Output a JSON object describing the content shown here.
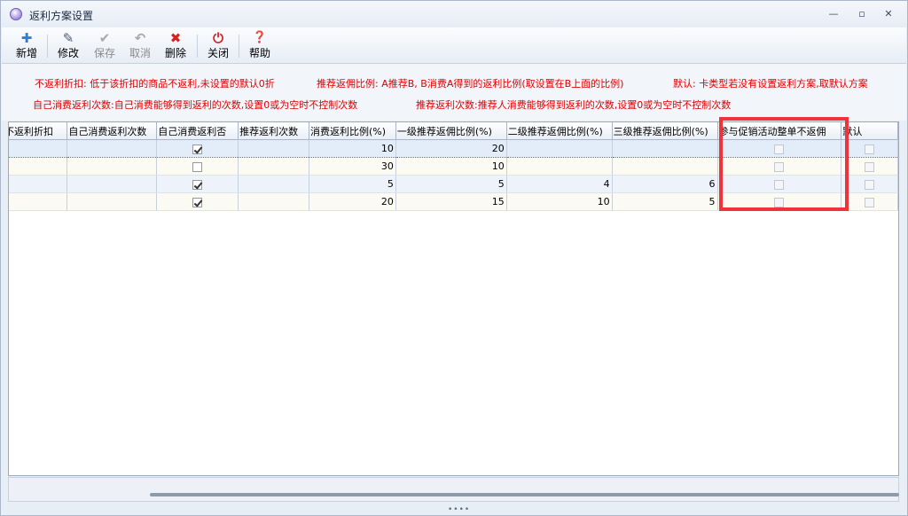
{
  "window": {
    "title": "返利方案设置",
    "controls": [
      "—",
      "▫",
      "✕"
    ]
  },
  "toolbar": {
    "buttons": [
      {
        "label": "新增",
        "icon": "plus-icon",
        "glyph": "✚",
        "color": "#2b7fd6",
        "enabled": true
      },
      {
        "label": "修改",
        "icon": "edit-icon",
        "glyph": "✎",
        "color": "#4b5b75",
        "enabled": true
      },
      {
        "label": "保存",
        "icon": "check-icon",
        "glyph": "✔",
        "color": "#a8a8a8",
        "enabled": false
      },
      {
        "label": "取消",
        "icon": "undo-icon",
        "glyph": "↶",
        "color": "#a8a8a8",
        "enabled": false
      },
      {
        "label": "删除",
        "icon": "delete-icon",
        "glyph": "✖",
        "color": "#d32222",
        "enabled": true
      },
      {
        "label": "关闭",
        "icon": "power-icon",
        "glyph": "⏻",
        "color": "#d32222",
        "enabled": true
      },
      {
        "label": "帮助",
        "icon": "help-icon",
        "glyph": "❓",
        "color": "#2b63c8",
        "enabled": true
      }
    ]
  },
  "info": {
    "line1a": "不返利折扣: 低于该折扣的商品不返利,未设置的默认0折",
    "line1b": "推荐返佣比例: A推荐B, B消费A得到的返利比例(取设置在B上面的比例)",
    "line1c": "默认: 卡类型若没有设置返利方案,取默认方案",
    "line2a": "自己消费返利次数:自己消费能够得到返利的次数,设置0或为空时不控制次数",
    "line2b": "推荐返利次数:推荐人消费能够得到返利的次数,设置0或为空时不控制次数"
  },
  "grid": {
    "columns": [
      "不返利折扣",
      "自己消费返利次数",
      "自己消费返利否",
      "推荐返利次数",
      "消费返利比例(%)",
      "一级推荐返佣比例(%)",
      "二级推荐返佣比例(%)",
      "三级推荐返佣比例(%)",
      "参与促销活动整单不返佣",
      "默认"
    ],
    "rows": [
      {
        "discount": "",
        "self_times": "",
        "self_rebate": true,
        "rec_times": "",
        "consume_ratio": "10",
        "lvl1": "20",
        "lvl2": "",
        "lvl3": "",
        "promo": false,
        "default": false
      },
      {
        "discount": "",
        "self_times": "",
        "self_rebate": false,
        "rec_times": "",
        "consume_ratio": "30",
        "lvl1": "10",
        "lvl2": "",
        "lvl3": "",
        "promo": false,
        "default": false
      },
      {
        "discount": "",
        "self_times": "",
        "self_rebate": true,
        "rec_times": "",
        "consume_ratio": "5",
        "lvl1": "5",
        "lvl2": "4",
        "lvl3": "6",
        "promo": false,
        "default": false
      },
      {
        "discount": "",
        "self_times": "",
        "self_rebate": true,
        "rec_times": "",
        "consume_ratio": "20",
        "lvl1": "15",
        "lvl2": "10",
        "lvl3": "5",
        "promo": false,
        "default": false
      }
    ]
  },
  "colors": {
    "highlight": "#f0323a",
    "info_text": "#e00000"
  }
}
